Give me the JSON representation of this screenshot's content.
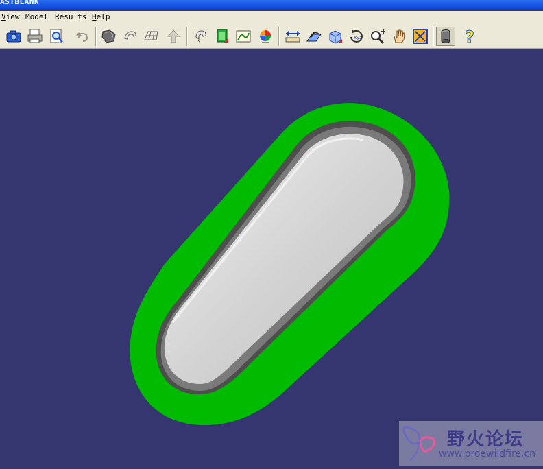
{
  "window": {
    "title": "ASTBLANK"
  },
  "menu": {
    "items": [
      {
        "label": "View",
        "accel": "V"
      },
      {
        "label": "Model",
        "accel": ""
      },
      {
        "label": "Results",
        "accel": ""
      },
      {
        "label": "Help",
        "accel": "H"
      }
    ]
  },
  "toolbar": {
    "icons": [
      "camera-icon",
      "print-icon",
      "print-preview-icon",
      "undo-icon",
      "shade-icon",
      "wireframe-icon",
      "mesh-icon",
      "arrow-up-icon",
      "rotate-view-icon",
      "fringe-icon",
      "graph-icon",
      "color-map-icon",
      "measure-icon",
      "dynamic-section-icon",
      "view-cube-icon",
      "spin-icon",
      "zoom-icon",
      "pan-icon",
      "fit-icon",
      "cylinder-icon",
      "help-icon"
    ]
  },
  "model": {
    "fill_color": "#00bb00",
    "cavity_color": "#d2d2d2",
    "background_color": "#35356f"
  },
  "watermark": {
    "title": "野火论坛",
    "url": "www.proewildfire.cn"
  }
}
